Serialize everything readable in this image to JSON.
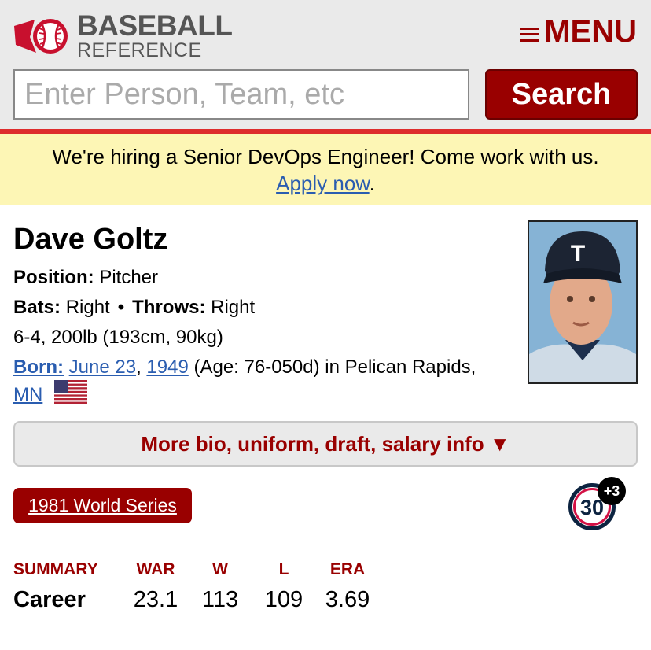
{
  "header": {
    "logo": {
      "line1": "BASEBALL",
      "line2": "REFERENCE"
    },
    "menu_label": "MENU"
  },
  "search": {
    "placeholder": "Enter Person, Team, etc",
    "value": "",
    "button_label": "Search"
  },
  "banner": {
    "text": "We're hiring a Senior DevOps Engineer! Come work with us.",
    "link_text": "Apply now",
    "trailing": "."
  },
  "player": {
    "name": "Dave Goltz",
    "position_label": "Position:",
    "position": "Pitcher",
    "bats_label": "Bats:",
    "bats": "Right",
    "bullet": "•",
    "throws_label": "Throws:",
    "throws": "Right",
    "size": "6-4, 200lb (193cm, 90kg)",
    "born_label": "Born:",
    "born_date": "June 23",
    "born_comma": ",",
    "born_year": "1949",
    "born_age": "(Age: 76-050d) in Pelican Rapids,",
    "born_state": "MN"
  },
  "more_bio_label": "More bio, uniform, draft, salary info ▼",
  "ws_badge": "1981 World Series",
  "jersey": {
    "number": "30",
    "extra": "+3",
    "colors": {
      "navy": "#0c2340",
      "red": "#d31145"
    }
  },
  "stats": {
    "headers": [
      "SUMMARY",
      "WAR",
      "W",
      "L",
      "ERA"
    ],
    "row": [
      "Career",
      "23.1",
      "113",
      "109",
      "3.69"
    ]
  },
  "colors": {
    "brand": "#990000",
    "link": "#2a5db0",
    "banner_bg": "#fdf6b5",
    "header_bg": "#eaeaea",
    "accent_line": "#de2c2c"
  },
  "icons": {
    "logo": "baseball-logo-icon",
    "menu": "hamburger-icon",
    "flag": "us-flag-icon"
  }
}
